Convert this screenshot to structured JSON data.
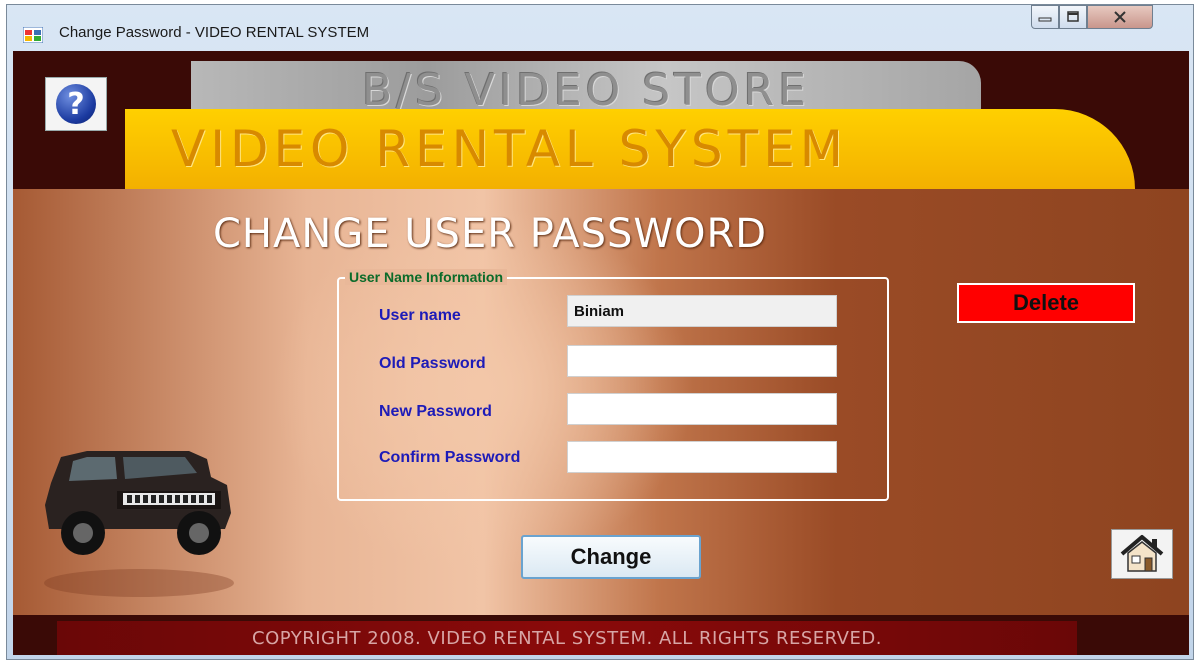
{
  "window": {
    "title": "Change Password  - VIDEO RENTAL SYSTEM",
    "icons": {
      "app": "app-window-icon",
      "minimize": "minimize-icon",
      "maximize": "maximize-icon",
      "close": "close-icon"
    }
  },
  "header": {
    "store_name": "B/S VIDEO STORE",
    "system_name": "VIDEO RENTAL SYSTEM",
    "help_icon": "help-question-icon"
  },
  "form": {
    "heading": "CHANGE USER PASSWORD",
    "group_label": "User Name Information",
    "fields": [
      {
        "label": "User name",
        "value": "Biniam"
      },
      {
        "label": "Old Password",
        "value": ""
      },
      {
        "label": "New Password",
        "value": ""
      },
      {
        "label": "Confirm Password",
        "value": ""
      }
    ],
    "delete_label": "Delete",
    "change_label": "Change",
    "home_icon": "home-icon"
  },
  "footer": {
    "copyright": "COPYRIGHT 2008. VIDEO RENTAL SYSTEM. ALL RIGHTS  RESERVED."
  },
  "colors": {
    "accent_yellow": "#f3b000",
    "delete_red": "#ff0000",
    "label_blue": "#1d1bb8",
    "legend_green": "#0b6b2a",
    "dark_maroon": "#3a0a06"
  }
}
